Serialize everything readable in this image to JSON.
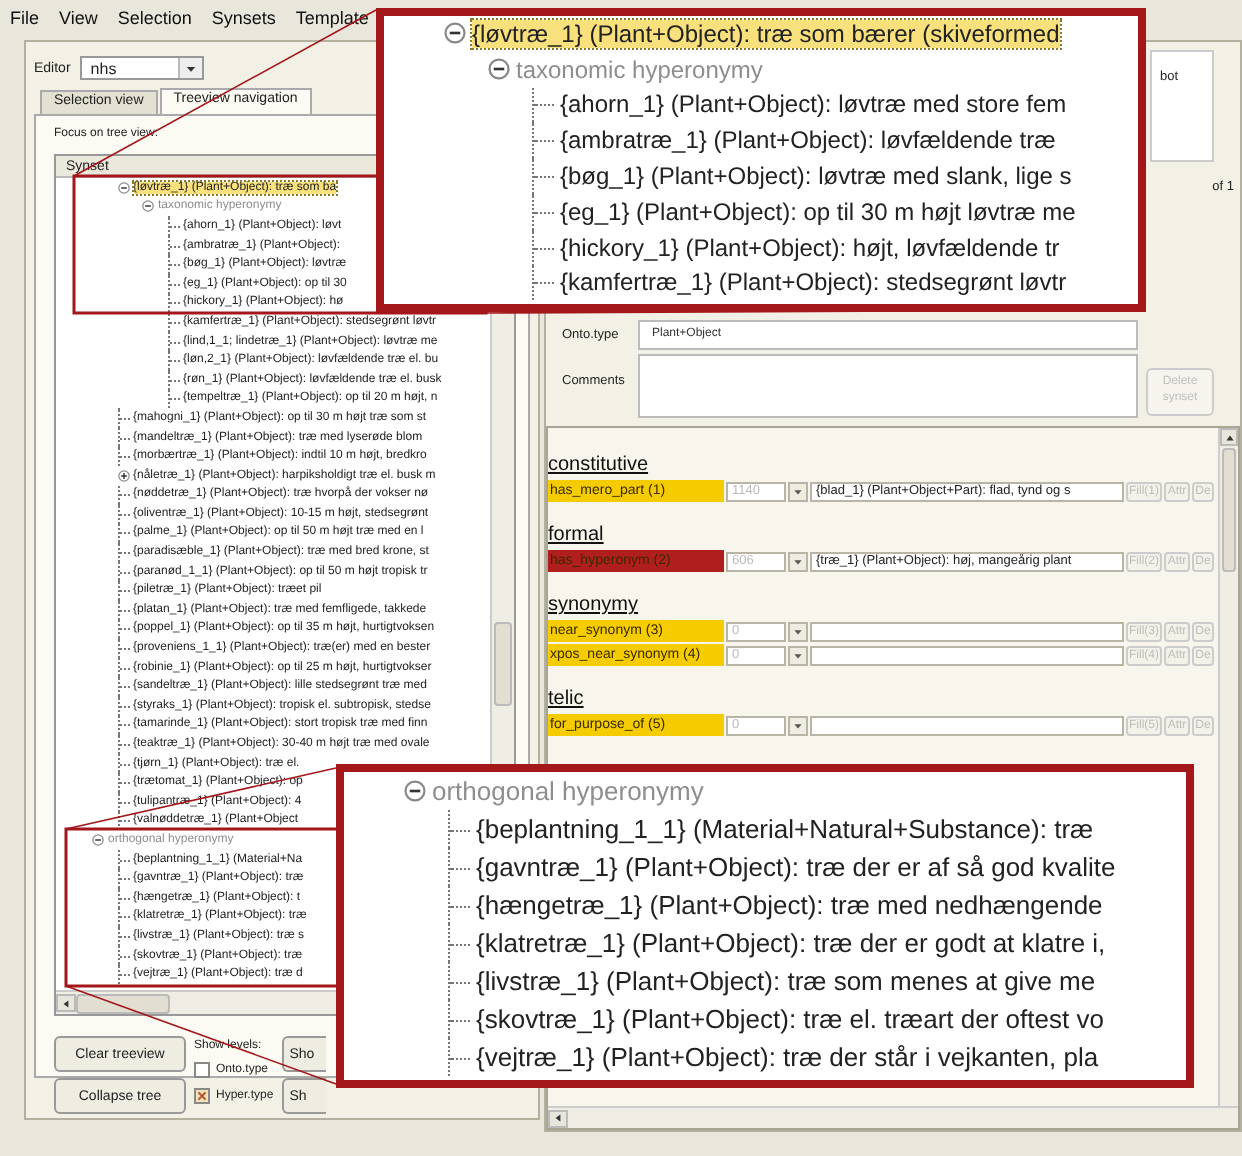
{
  "menu": [
    {
      "label": "File"
    },
    {
      "label": "View"
    },
    {
      "label": "Selection"
    },
    {
      "label": "Synsets"
    },
    {
      "label": "Template"
    }
  ],
  "editor": {
    "label": "Editor",
    "value": "nhs"
  },
  "tabs": [
    {
      "label": "Selection view",
      "selected": false
    },
    {
      "label": "Treeview navigation",
      "selected": true
    }
  ],
  "focus_label": "Focus on tree view:",
  "tree": {
    "column": "Synset",
    "nodes": [
      {
        "kind": "continuation",
        "children": [
          {
            "kind": "synset",
            "label": "{løvtræ_1} (Plant+Object): træ som ba",
            "selected": true,
            "expanded": true,
            "children": [
              {
                "kind": "relation",
                "label": "taxonomic hyperonymy",
                "expanded": true,
                "children": [
                  {
                    "kind": "synset",
                    "label": "{ahorn_1} (Plant+Object): løvt",
                    "selected": false
                  },
                  {
                    "kind": "synset",
                    "label": "{ambratræ_1} (Plant+Object):",
                    "selected": false
                  },
                  {
                    "kind": "synset",
                    "label": "{bøg_1} (Plant+Object): løvtræ",
                    "selected": false
                  },
                  {
                    "kind": "synset",
                    "label": "{eg_1} (Plant+Object): op til 30",
                    "selected": false
                  },
                  {
                    "kind": "synset",
                    "label": "{hickory_1} (Plant+Object): hø",
                    "selected": false
                  },
                  {
                    "kind": "synset",
                    "label": "{kamfertræ_1} (Plant+Object): stedsegrønt løvtr",
                    "selected": false
                  },
                  {
                    "kind": "synset",
                    "label": "{lind,1_1; lindetræ_1} (Plant+Object): løvtræ me",
                    "selected": false
                  },
                  {
                    "kind": "synset",
                    "label": "{løn,2_1} (Plant+Object): løvfældende træ el. bu",
                    "selected": false
                  },
                  {
                    "kind": "synset",
                    "label": "{røn_1} (Plant+Object): løvfældende træ el. busk",
                    "selected": false
                  },
                  {
                    "kind": "synset",
                    "label": "{tempeltræ_1} (Plant+Object): op til 20 m højt, n",
                    "selected": false
                  }
                ]
              }
            ]
          },
          {
            "kind": "synset",
            "label": "{mahogni_1} (Plant+Object): op til 30 m højt træ som st",
            "selected": false
          },
          {
            "kind": "synset",
            "label": "{mandeltræ_1} (Plant+Object): træ med lyserøde blom",
            "selected": false
          },
          {
            "kind": "synset",
            "label": "{morbærtræ_1} (Plant+Object): indtil 10 m højt, bredkro",
            "selected": false
          },
          {
            "kind": "synset",
            "label": "{nåletræ_1} (Plant+Object): harpiksholdigt træ el. busk m",
            "selected": false,
            "expanded": false
          },
          {
            "kind": "synset",
            "label": "{nøddetræ_1} (Plant+Object): træ hvorpå der vokser nø",
            "selected": false
          },
          {
            "kind": "synset",
            "label": "{oliventræ_1} (Plant+Object): 10-15 m højt, stedsegrønt",
            "selected": false
          },
          {
            "kind": "synset",
            "label": "{palme_1} (Plant+Object): op til 50 m højt træ med en l",
            "selected": false
          },
          {
            "kind": "synset",
            "label": "{paradisæble_1} (Plant+Object): træ med bred krone, st",
            "selected": false
          },
          {
            "kind": "synset",
            "label": "{paranød_1_1} (Plant+Object): op til 50 m højt tropisk tr",
            "selected": false
          },
          {
            "kind": "synset",
            "label": "{piletræ_1} (Plant+Object): træet pil",
            "selected": false
          },
          {
            "kind": "synset",
            "label": "{platan_1} (Plant+Object): træ med femfligede, takkede",
            "selected": false
          },
          {
            "kind": "synset",
            "label": "{poppel_1} (Plant+Object): op til 35 m højt, hurtigtvoksen",
            "selected": false
          },
          {
            "kind": "synset",
            "label": "{proveniens_1_1} (Plant+Object): træ(er) med en bester",
            "selected": false
          },
          {
            "kind": "synset",
            "label": "{robinie_1} (Plant+Object): op til 25 m højt, hurtigtvokser",
            "selected": false
          },
          {
            "kind": "synset",
            "label": "{sandeltræ_1} (Plant+Object): lille stedsegrønt træ med",
            "selected": false
          },
          {
            "kind": "synset",
            "label": "{styraks_1} (Plant+Object): tropisk el. subtropisk, stedse",
            "selected": false
          },
          {
            "kind": "synset",
            "label": "{tamarinde_1} (Plant+Object): stort tropisk træ med finn",
            "selected": false
          },
          {
            "kind": "synset",
            "label": "{teaktræ_1} (Plant+Object): 30-40 m højt træ med ovale",
            "selected": false
          },
          {
            "kind": "synset",
            "label": "{tjørn_1} (Plant+Object): træ el.",
            "selected": false
          },
          {
            "kind": "synset",
            "label": "{trætomat_1} (Plant+Object): op",
            "selected": false
          },
          {
            "kind": "synset",
            "label": "{tulipantræ_1} (Plant+Object): 4",
            "selected": false
          },
          {
            "kind": "synset",
            "label": "{valnøddetræ_1} (Plant+Object",
            "selected": false
          }
        ]
      },
      {
        "kind": "relation",
        "label": "orthogonal hyperonymy",
        "expanded": true,
        "children": [
          {
            "kind": "synset",
            "label": "{beplantning_1_1} (Material+Na",
            "selected": false
          },
          {
            "kind": "synset",
            "label": "{gavntræ_1} (Plant+Object): træ",
            "selected": false
          },
          {
            "kind": "synset",
            "label": "{hængetræ_1} (Plant+Object): t",
            "selected": false
          },
          {
            "kind": "synset",
            "label": "{klatretræ_1} (Plant+Object): træ",
            "selected": false
          },
          {
            "kind": "synset",
            "label": "{livstræ_1} (Plant+Object): træ s",
            "selected": false
          },
          {
            "kind": "synset",
            "label": "{skovtræ_1} (Plant+Object): træ",
            "selected": false
          },
          {
            "kind": "synset",
            "label": "{vejtræ_1} (Plant+Object): træ d",
            "selected": false
          }
        ]
      }
    ]
  },
  "tree_buttons": [
    {
      "label": "Clear treeview"
    },
    {
      "label": "Collapse tree"
    }
  ],
  "show_levels": {
    "label": "Show levels:",
    "options": [
      {
        "label": "Onto.type",
        "checked": false
      },
      {
        "label": "Hyper.type",
        "checked": true
      }
    ]
  },
  "show_buttons": [
    {
      "label": "Sho"
    },
    {
      "label": "Sh"
    }
  ],
  "synset_field": {
    "value": "bot",
    "counter": "of 1"
  },
  "onto_type": {
    "label": "Onto.type",
    "value": "Plant+Object"
  },
  "comments": {
    "label": "Comments"
  },
  "delete_button": {
    "label": "Delete synset",
    "disabled": true
  },
  "relations": [
    {
      "title": "constitutive",
      "rows": [
        {
          "label": "has_mero_part (1)",
          "color": "#f5cc00",
          "count": "1140",
          "target": "{blad_1} (Plant+Object+Part): flad, tynd og s",
          "fill": "Fill(1)",
          "attr": "Attr",
          "del": "De",
          "disabled": true
        }
      ]
    },
    {
      "title": "formal",
      "rows": [
        {
          "label": "has_hyperonym (2)",
          "color": "#b01e1e",
          "count": "606",
          "target": "{træ_1} (Plant+Object): høj, mangeårig plant",
          "fill": "Fill(2)",
          "attr": "Attr",
          "del": "De",
          "disabled": true
        }
      ]
    },
    {
      "title": "synonymy",
      "rows": [
        {
          "label": "near_synonym (3)",
          "color": "#f5cc00",
          "count": "0",
          "target": "",
          "fill": "Fill(3)",
          "attr": "Attr",
          "del": "De",
          "disabled": true
        },
        {
          "label": "xpos_near_synonym (4)",
          "color": "#f5cc00",
          "count": "0",
          "target": "",
          "fill": "Fill(4)",
          "attr": "Attr",
          "del": "De",
          "disabled": true
        }
      ]
    },
    {
      "title": "telic",
      "rows": [
        {
          "label": "for_purpose_of (5)",
          "color": "#f5cc00",
          "count": "0",
          "target": "",
          "fill": "Fill(5)",
          "attr": "Attr",
          "del": "De",
          "disabled": true
        }
      ]
    }
  ],
  "callouts": [
    {
      "nodes": [
        {
          "kind": "synset",
          "label": "{løvtræ_1} (Plant+Object): træ som bærer (skiveformed",
          "selected": true,
          "expanded": true,
          "children": [
            {
              "kind": "relation",
              "label": "taxonomic hyperonymy",
              "expanded": true,
              "children": [
                {
                  "kind": "synset",
                  "label": "{ahorn_1} (Plant+Object): løvtræ med store fem",
                  "selected": false
                },
                {
                  "kind": "synset",
                  "label": "{ambratræ_1} (Plant+Object): løvfældende træ",
                  "selected": false
                },
                {
                  "kind": "synset",
                  "label": "{bøg_1} (Plant+Object): løvtræ med slank, lige s",
                  "selected": false
                },
                {
                  "kind": "synset",
                  "label": "{eg_1} (Plant+Object): op til 30 m højt løvtræ me",
                  "selected": false
                },
                {
                  "kind": "synset",
                  "label": "{hickory_1} (Plant+Object): højt, løvfældende tr",
                  "selected": false
                },
                {
                  "kind": "synset",
                  "label": "{kamfertræ_1} (Plant+Object): stedsegrønt løvtr",
                  "selected": false
                }
              ]
            }
          ]
        }
      ]
    },
    {
      "nodes": [
        {
          "kind": "relation",
          "label": "orthogonal hyperonymy",
          "expanded": true,
          "children": [
            {
              "kind": "synset",
              "label": "{beplantning_1_1} (Material+Natural+Substance): træ",
              "selected": false
            },
            {
              "kind": "synset",
              "label": "{gavntræ_1} (Plant+Object): træ der er af så god kvalite",
              "selected": false
            },
            {
              "kind": "synset",
              "label": "{hængetræ_1} (Plant+Object): træ med nedhængende",
              "selected": false
            },
            {
              "kind": "synset",
              "label": "{klatretræ_1} (Plant+Object): træ der er godt at klatre i,",
              "selected": false
            },
            {
              "kind": "synset",
              "label": "{livstræ_1} (Plant+Object): træ som menes at give me",
              "selected": false
            },
            {
              "kind": "synset",
              "label": "{skovtræ_1} (Plant+Object): træ el. træart der oftest vo",
              "selected": false
            },
            {
              "kind": "synset",
              "label": "{vejtræ_1} (Plant+Object): træ der står i vejkanten, pla",
              "selected": false
            }
          ]
        }
      ]
    }
  ]
}
